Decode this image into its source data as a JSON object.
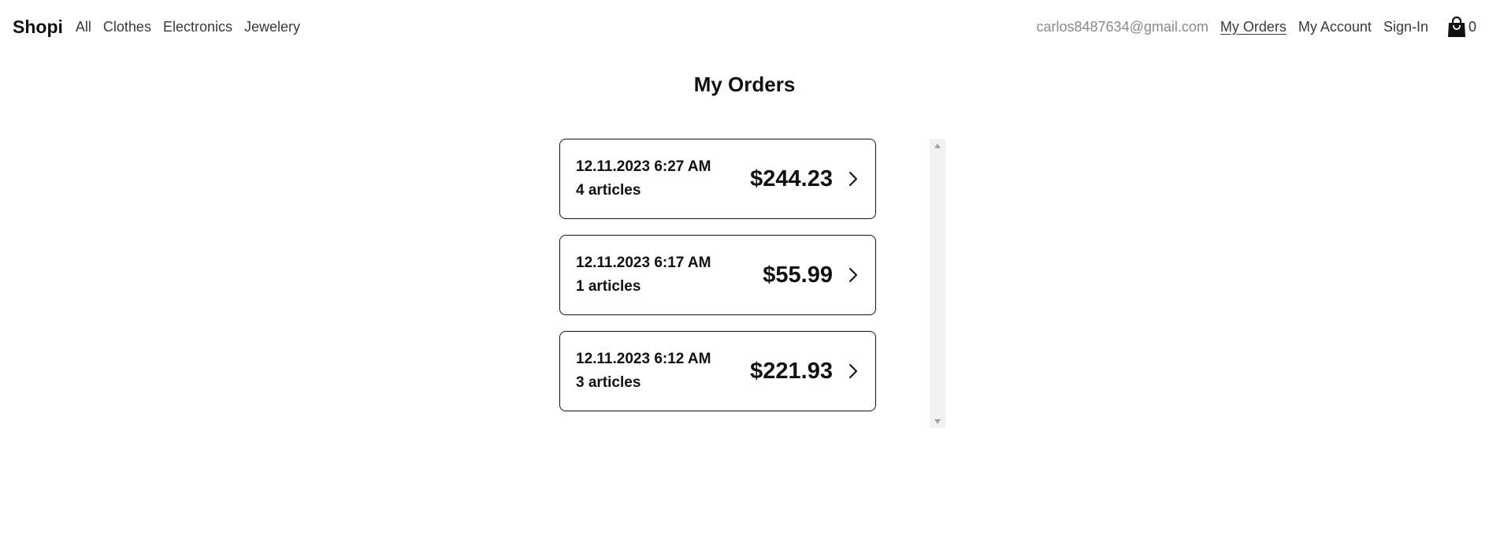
{
  "nav": {
    "brand": "Shopi",
    "categories": [
      {
        "label": "All"
      },
      {
        "label": "Clothes"
      },
      {
        "label": "Electronics"
      },
      {
        "label": "Jewelery"
      }
    ],
    "user_email": "carlos8487634@gmail.com",
    "my_orders": "My Orders",
    "my_account": "My Account",
    "sign_in": "Sign-In",
    "cart_icon": "shopping-bag-icon",
    "cart_count": "0"
  },
  "page": {
    "title": "My Orders"
  },
  "orders": [
    {
      "date": "12.11.2023 6:27 AM",
      "articles": "4 articles",
      "total": "$244.23"
    },
    {
      "date": "12.11.2023 6:17 AM",
      "articles": "1 articles",
      "total": "$55.99"
    },
    {
      "date": "12.11.2023 6:12 AM",
      "articles": "3 articles",
      "total": "$221.93"
    }
  ],
  "colors": {
    "text": "#111111",
    "muted": "#8a8a8a",
    "card_border": "#111111",
    "scrollbar_track": "#f1f1f1"
  }
}
